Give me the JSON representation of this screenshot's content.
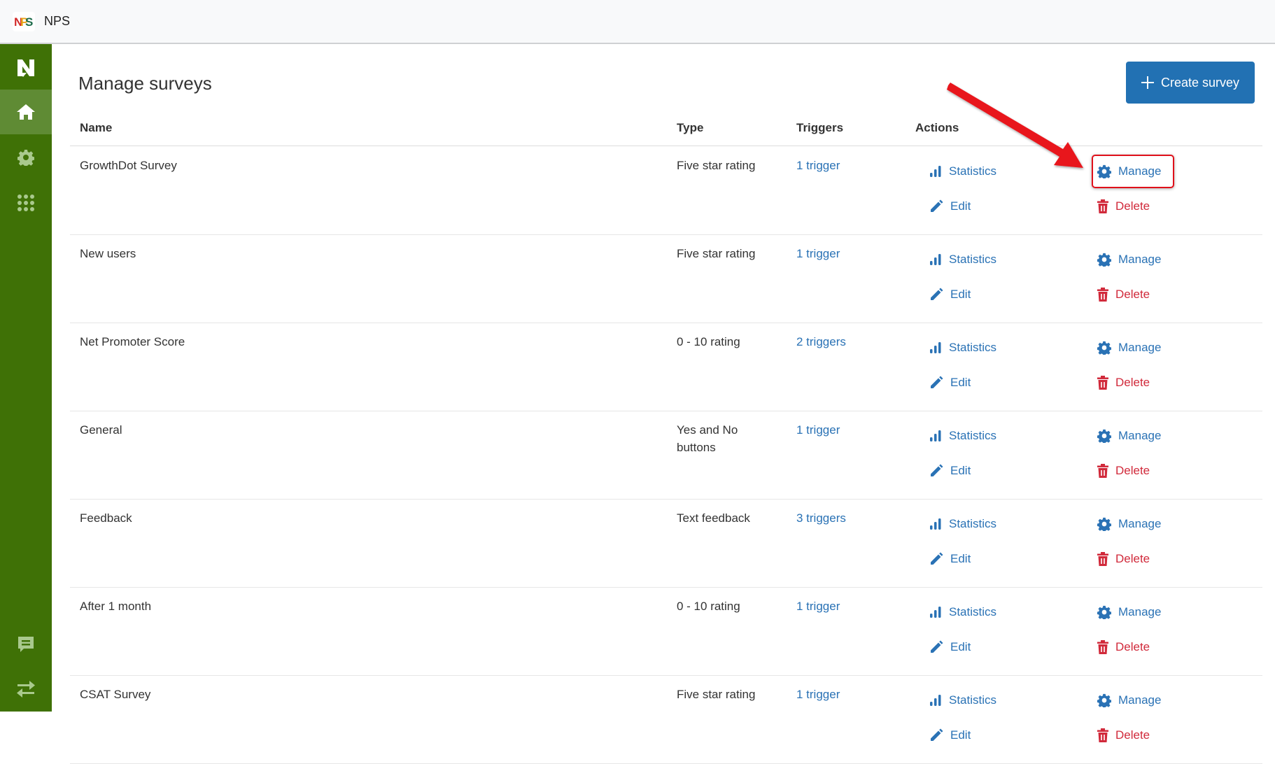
{
  "app": {
    "name": "NPS",
    "logo_text": "NPS"
  },
  "sidebar": {
    "items": [
      {
        "name": "brand-logo",
        "icon": "n-logo-icon"
      },
      {
        "name": "home",
        "icon": "home-icon",
        "active": true
      },
      {
        "name": "settings",
        "icon": "gear-icon"
      },
      {
        "name": "apps",
        "icon": "grid-icon"
      },
      {
        "name": "feedback",
        "icon": "chat-icon"
      },
      {
        "name": "switch",
        "icon": "swap-arrows-icon"
      }
    ]
  },
  "page": {
    "title": "Manage surveys",
    "create_button": "Create survey"
  },
  "table": {
    "headers": {
      "name": "Name",
      "type": "Type",
      "triggers": "Triggers",
      "actions": "Actions"
    },
    "action_labels": {
      "statistics": "Statistics",
      "edit": "Edit",
      "manage": "Manage",
      "delete": "Delete"
    },
    "rows": [
      {
        "name": "GrowthDot Survey",
        "type": "Five star rating",
        "triggers": "1 trigger"
      },
      {
        "name": "New users",
        "type": "Five star rating",
        "triggers": "1 trigger"
      },
      {
        "name": "Net Promoter Score",
        "type": "0 - 10 rating",
        "triggers": "2 triggers"
      },
      {
        "name": "General",
        "type": "Yes and No buttons",
        "triggers": "1 trigger"
      },
      {
        "name": "Feedback",
        "type": "Text feedback",
        "triggers": "3 triggers"
      },
      {
        "name": "After 1 month",
        "type": "0 - 10 rating",
        "triggers": "1 trigger"
      },
      {
        "name": "CSAT Survey",
        "type": "Five star rating",
        "triggers": "1 trigger"
      }
    ]
  },
  "annotation": {
    "highlighted": "Manage",
    "color": "#e0101a"
  },
  "colors": {
    "sidebar": "#3f7106",
    "primary": "#2271b3",
    "link": "#2a72b5",
    "danger": "#d12a3b"
  }
}
